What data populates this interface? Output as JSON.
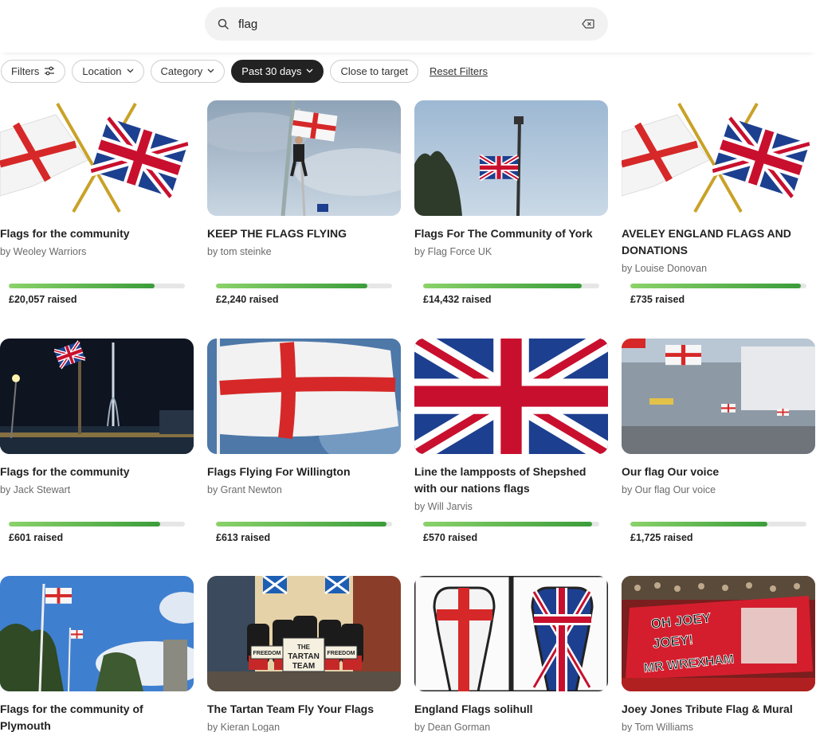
{
  "search": {
    "value": "flag",
    "placeholder": ""
  },
  "filters": {
    "chips": [
      {
        "label": "Filters",
        "icon": "sliders-icon",
        "active": false
      },
      {
        "label": "Location",
        "icon": "chevron-down-icon",
        "active": false
      },
      {
        "label": "Category",
        "icon": "chevron-down-icon",
        "active": false
      },
      {
        "label": "Past 30 days",
        "icon": "chevron-down-icon",
        "active": true
      },
      {
        "label": "Close to target",
        "icon": "",
        "active": false
      }
    ],
    "reset_label": "Reset Filters"
  },
  "cards": [
    {
      "title": "Flags for the community",
      "by": "by Weoley Warriors",
      "raised": "£20,057 raised",
      "progress": 0.83,
      "image": "crossed-flags"
    },
    {
      "title": "KEEP THE FLAGS FLYING",
      "by": "by tom steinke",
      "raised": "£2,240 raised",
      "progress": 0.86,
      "image": "man-climbing-pole"
    },
    {
      "title": "Flags For The Community of York",
      "by": "by Flag Force UK",
      "raised": "£14,432 raised",
      "progress": 0.9,
      "image": "union-flag-lamppost"
    },
    {
      "title": "AVELEY ENGLAND FLAGS AND DONATIONS",
      "by": "by Louise Donovan",
      "raised": "£735 raised",
      "progress": 0.97,
      "image": "crossed-flags"
    },
    {
      "title": "Flags for the community",
      "by": "by Jack Stewart",
      "raised": "£601 raised",
      "progress": 0.86,
      "image": "night-harbour-tower"
    },
    {
      "title": "Flags Flying For Willington",
      "by": "by Grant Newton",
      "raised": "£613 raised",
      "progress": 0.97,
      "image": "st-george-flag"
    },
    {
      "title": "Line the lampposts of Shepshed with our nations flags",
      "by": "by Will Jarvis",
      "raised": "£570 raised",
      "progress": 0.96,
      "image": "union-flag"
    },
    {
      "title": "Our flag Our voice",
      "by": "by Our flag Our voice",
      "raised": "£1,725 raised",
      "progress": 0.78,
      "image": "street-flags"
    },
    {
      "title": "Flags for the community of Plymouth",
      "by": "",
      "raised": "",
      "progress": null,
      "image": "flagpoles-sky"
    },
    {
      "title": "The Tartan Team Fly Your Flags",
      "by": "by Kieran Logan",
      "raised": "",
      "progress": null,
      "image": "tartan-team"
    },
    {
      "title": "England Flags solihull",
      "by": "by Dean Gorman",
      "raised": "",
      "progress": null,
      "image": "fists"
    },
    {
      "title": "Joey Jones Tribute Flag & Mural",
      "by": "by Tom Williams",
      "raised": "",
      "progress": null,
      "image": "stadium-banner"
    }
  ],
  "image_text": {
    "tartan_sign": "THE TARTAN TEAM",
    "freedom": "FREEDOM",
    "banner_line1": "OH JOEY",
    "banner_line2": "JOEY!",
    "banner_line3": "MR WREXHAM"
  },
  "colors": {
    "progress_start": "#8bd26a",
    "progress_end": "#3a9d3a",
    "chip_active_bg": "#222222",
    "st_george_red": "#d62828",
    "union_blue": "#1d3f8f"
  }
}
